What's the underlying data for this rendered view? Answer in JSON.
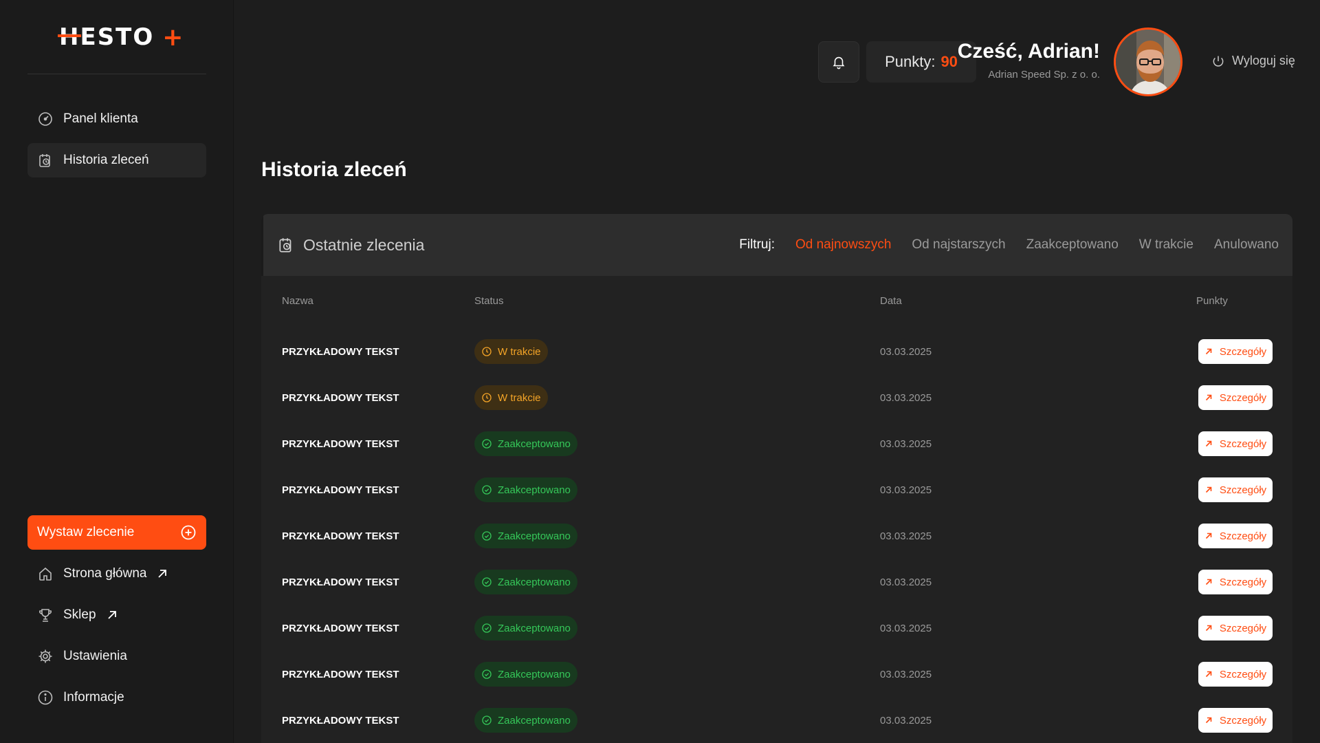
{
  "brand": {
    "logo_text_first": "H",
    "logo_text_rest": "ESTO",
    "logo_plus": "+",
    "accent": "#ff4d12"
  },
  "sidebar": {
    "items": [
      {
        "label": "Panel klienta",
        "icon": "gauge-icon"
      },
      {
        "label": "Historia zleceń",
        "icon": "history-icon",
        "active": true
      }
    ],
    "cta_label": "Wystaw zlecenie",
    "bottom_items": [
      {
        "label": "Strona główna",
        "icon": "home-icon",
        "external": true
      },
      {
        "label": "Sklep",
        "icon": "trophy-icon",
        "external": true
      },
      {
        "label": "Ustawienia",
        "icon": "gear-icon"
      },
      {
        "label": "Informacje",
        "icon": "info-icon"
      }
    ]
  },
  "header": {
    "points_label": "Punkty:",
    "points_value": "90",
    "greeting": "Cześć, Adrian!",
    "company": "Adrian Speed Sp. z o. o.",
    "logout_label": "Wyloguj się"
  },
  "main": {
    "page_title": "Historia zleceń",
    "card_title": "Ostatnie zlecenia",
    "filter_label": "Filtruj:",
    "filters": [
      "Od najnowszych",
      "Od najstarszych",
      "Zaakceptowano",
      "W trakcie",
      "Anulowano"
    ],
    "active_filter": "Od najnowszych",
    "columns": {
      "name": "Nazwa",
      "status": "Status",
      "date": "Data",
      "points": "Punkty"
    },
    "details_label": "Szczegóły",
    "rows": [
      {
        "name": "PRZYKŁADOWY TEKST",
        "status": "W trakcie",
        "status_type": "progress",
        "date": "03.03.2025"
      },
      {
        "name": "PRZYKŁADOWY TEKST",
        "status": "W trakcie",
        "status_type": "progress",
        "date": "03.03.2025"
      },
      {
        "name": "PRZYKŁADOWY TEKST",
        "status": "Zaakceptowano",
        "status_type": "accepted",
        "date": "03.03.2025"
      },
      {
        "name": "PRZYKŁADOWY TEKST",
        "status": "Zaakceptowano",
        "status_type": "accepted",
        "date": "03.03.2025"
      },
      {
        "name": "PRZYKŁADOWY TEKST",
        "status": "Zaakceptowano",
        "status_type": "accepted",
        "date": "03.03.2025"
      },
      {
        "name": "PRZYKŁADOWY TEKST",
        "status": "Zaakceptowano",
        "status_type": "accepted",
        "date": "03.03.2025"
      },
      {
        "name": "PRZYKŁADOWY TEKST",
        "status": "Zaakceptowano",
        "status_type": "accepted",
        "date": "03.03.2025"
      },
      {
        "name": "PRZYKŁADOWY TEKST",
        "status": "Zaakceptowano",
        "status_type": "accepted",
        "date": "03.03.2025"
      },
      {
        "name": "PRZYKŁADOWY TEKST",
        "status": "Zaakceptowano",
        "status_type": "accepted",
        "date": "03.03.2025"
      }
    ]
  }
}
